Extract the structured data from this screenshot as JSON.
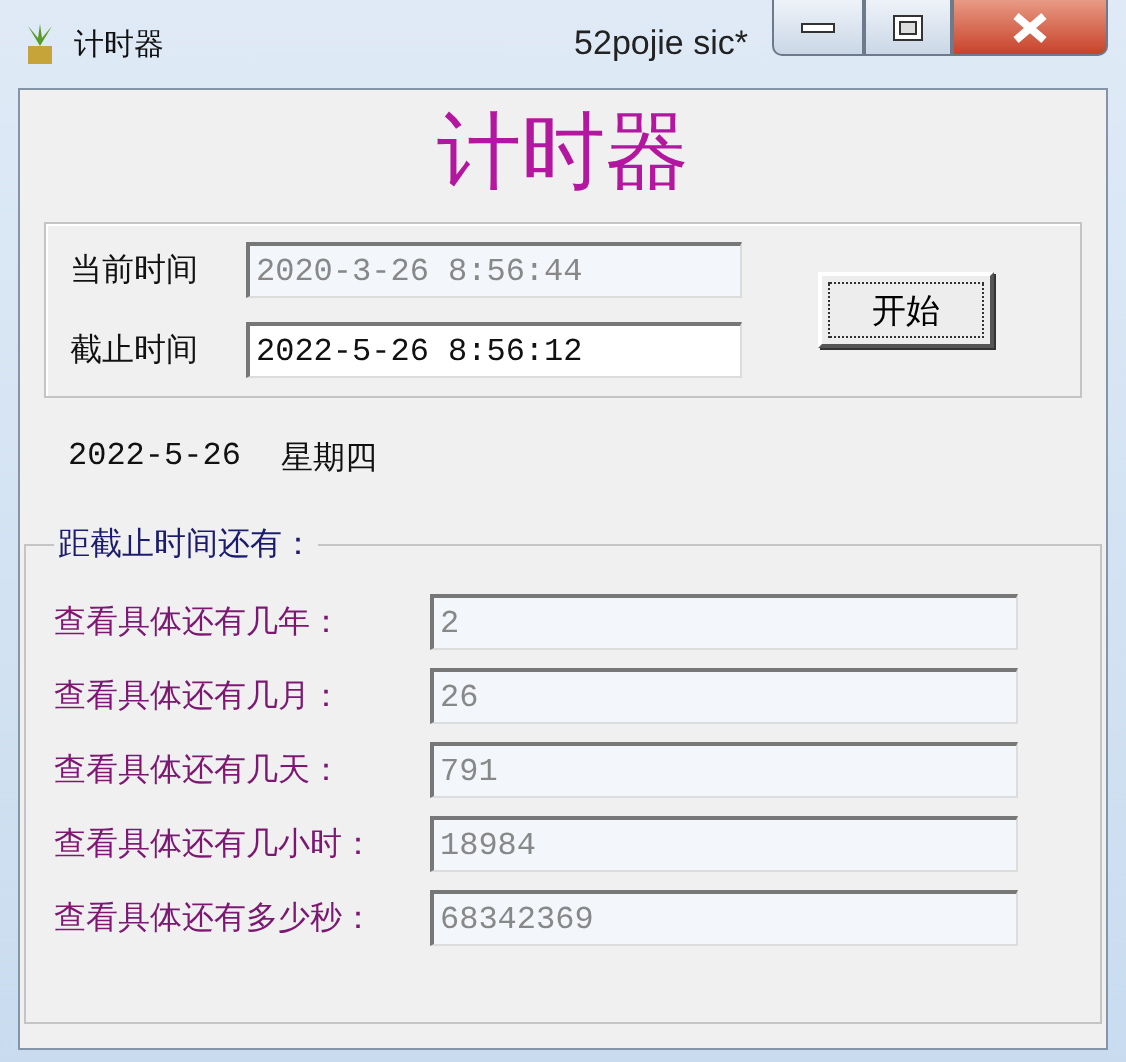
{
  "window": {
    "title": "计时器",
    "caption_text": "52pojie sic*"
  },
  "heading": "计时器",
  "time_group": {
    "rows": [
      {
        "label": "当前时间",
        "value": "2020-3-26 8:56:44",
        "disabled": true
      },
      {
        "label": "截止时间",
        "value": "2022-5-26 8:56:12",
        "disabled": false
      }
    ],
    "start_button": "开始"
  },
  "date_line": {
    "date": "2022-5-26",
    "weekday": "星期四"
  },
  "remaining_group": {
    "title": "距截止时间还有：",
    "rows": [
      {
        "label": "查看具体还有几年：",
        "value": "2",
        "disabled": true
      },
      {
        "label": "查看具体还有几月：",
        "value": "26",
        "disabled": true
      },
      {
        "label": "查看具体还有几天：",
        "value": "791",
        "disabled": true
      },
      {
        "label": "查看具体还有几小时：",
        "value": "18984",
        "disabled": true
      },
      {
        "label": "查看具体还有多少秒：",
        "value": "68342369",
        "disabled": true
      }
    ]
  }
}
